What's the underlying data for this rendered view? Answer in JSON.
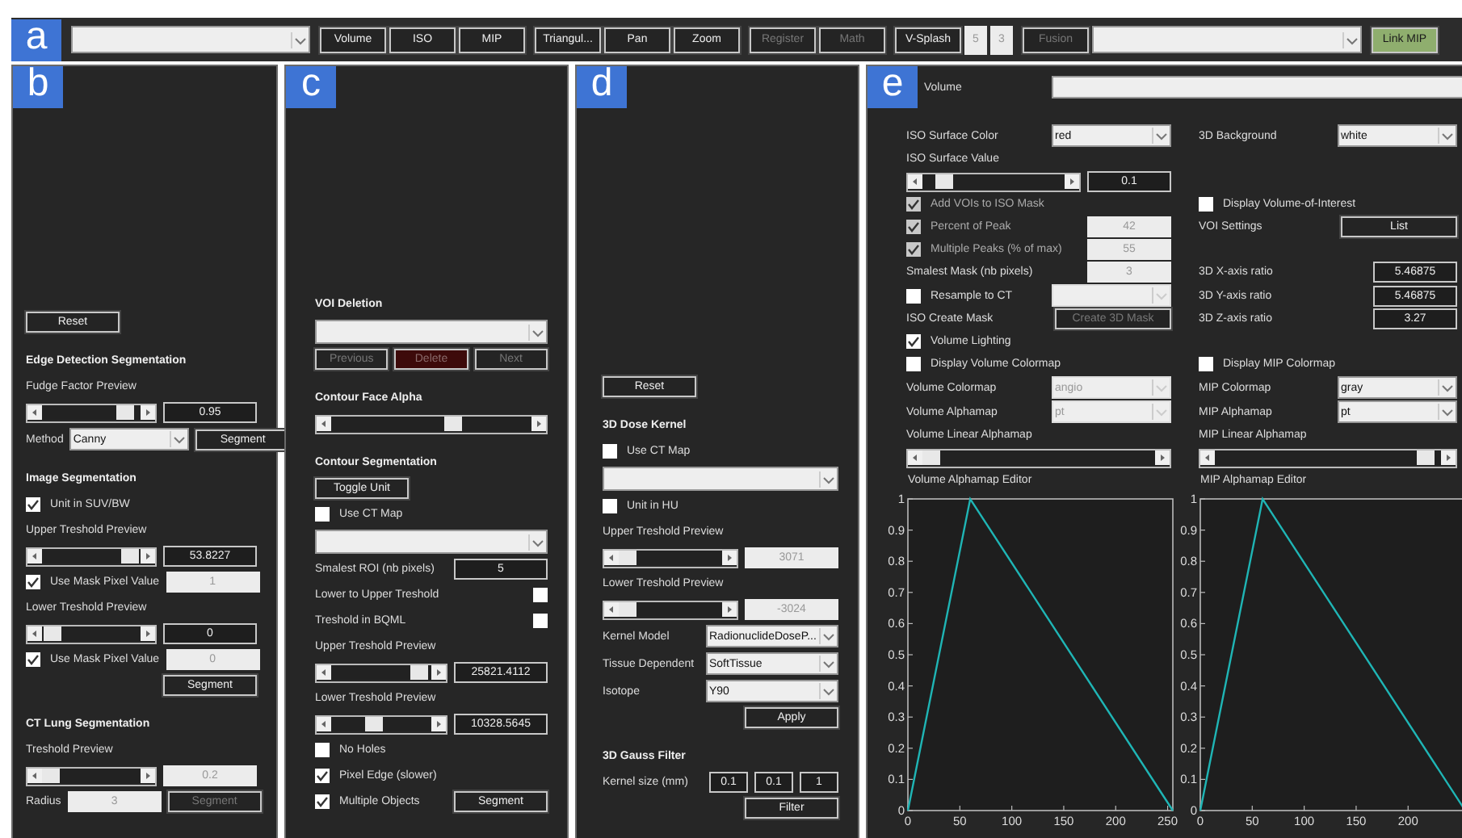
{
  "toolbar": {
    "letter": "a",
    "groups": [
      [
        {
          "kind": "dropdown",
          "disabled": false
        }
      ],
      [
        {
          "kind": "button",
          "label": "Volume",
          "disabled": false
        },
        {
          "kind": "button",
          "label": "ISO",
          "disabled": false
        },
        {
          "kind": "button",
          "label": "MIP",
          "disabled": false
        }
      ],
      [
        {
          "kind": "button",
          "label": "Triangul...",
          "disabled": false
        },
        {
          "kind": "button",
          "label": "Pan",
          "disabled": false
        },
        {
          "kind": "button",
          "label": "Zoom",
          "disabled": false
        }
      ],
      [
        {
          "kind": "button",
          "label": "Register",
          "disabled": true
        },
        {
          "kind": "button",
          "label": "Math",
          "disabled": true
        }
      ],
      [
        {
          "kind": "button",
          "label": "V-Splash",
          "disabled": false
        },
        {
          "kind": "field",
          "value": "5",
          "disabled": true
        },
        {
          "kind": "field",
          "value": "3",
          "disabled": true
        }
      ],
      [
        {
          "kind": "button",
          "label": "Fusion",
          "disabled": true
        },
        {
          "kind": "dropdown",
          "disabled": false
        }
      ],
      [
        {
          "kind": "button",
          "label": "Link MIP",
          "disabled": false,
          "color": "#8fae6e"
        }
      ]
    ]
  },
  "panels": [
    {
      "letter": "b",
      "rows": [
        {
          "items": [
            {
              "kind": "button",
              "label": "Reset",
              "disabled": false
            }
          ]
        },
        {
          "items": [
            {
              "kind": "heading",
              "text": "Edge Detection Segmentation"
            }
          ]
        },
        {
          "items": [
            {
              "kind": "text",
              "text": "Fudge Factor Preview"
            }
          ]
        },
        {
          "items": [
            {
              "kind": "slider",
              "level": 0.92
            },
            {
              "kind": "field",
              "value": "0.95",
              "disabled": false
            }
          ]
        },
        {
          "items": [
            {
              "kind": "text",
              "text": "Method"
            },
            {
              "kind": "dropdown",
              "value": "Canny",
              "disabled": false
            },
            {
              "kind": "button",
              "label": "Segment",
              "disabled": false
            }
          ]
        },
        {
          "items": [
            {
              "kind": "heading",
              "text": "Image Segmentation"
            }
          ]
        },
        {
          "items": [
            {
              "kind": "checkbox",
              "label": "Unit in SUV/BW",
              "checked": true,
              "disabled": false
            }
          ]
        },
        {
          "items": [
            {
              "kind": "text",
              "text": "Upper Treshold Preview"
            }
          ]
        },
        {
          "items": [
            {
              "kind": "slider",
              "level": 0.97
            },
            {
              "kind": "field",
              "value": "53.8227",
              "disabled": false
            }
          ]
        },
        {
          "items": [
            {
              "kind": "checkbox",
              "label": "Use Mask Pixel Value",
              "checked": true,
              "disabled": false
            },
            {
              "kind": "field",
              "value": "1",
              "disabled": true
            }
          ]
        },
        {
          "items": [
            {
              "kind": "text",
              "text": "Lower Treshold Preview"
            }
          ]
        },
        {
          "items": [
            {
              "kind": "slider",
              "level": 0.03
            },
            {
              "kind": "field",
              "value": "0",
              "disabled": false
            }
          ]
        },
        {
          "items": [
            {
              "kind": "checkbox",
              "label": "Use Mask Pixel Value",
              "checked": true,
              "disabled": false
            },
            {
              "kind": "field",
              "value": "0",
              "disabled": true
            }
          ]
        },
        {
          "items": [
            {
              "kind": "button",
              "label": "Segment",
              "disabled": false
            }
          ]
        },
        {
          "items": [
            {
              "kind": "heading",
              "text": "CT Lung Segmentation"
            }
          ]
        },
        {
          "items": [
            {
              "kind": "text",
              "text": "Treshold Preview"
            }
          ]
        },
        {
          "items": [
            {
              "kind": "slider",
              "level": 0
            },
            {
              "kind": "field",
              "value": "0.2",
              "disabled": true
            }
          ]
        },
        {
          "items": [
            {
              "kind": "text",
              "text": "Radius"
            },
            {
              "kind": "field",
              "value": "3",
              "disabled": true
            },
            {
              "kind": "button",
              "label": "Segment",
              "disabled": true
            }
          ]
        }
      ]
    },
    {
      "letter": "c",
      "rows": [
        {
          "items": [
            {
              "kind": "heading",
              "text": "VOI Deletion"
            }
          ]
        },
        {
          "items": [
            {
              "kind": "dropdown",
              "disabled": false
            }
          ]
        },
        {
          "items": [
            {
              "kind": "button",
              "label": "Previous",
              "disabled": true
            },
            {
              "kind": "button",
              "label": "Delete",
              "disabled": true,
              "color": "#3d0a0a"
            },
            {
              "kind": "button",
              "label": "Next",
              "disabled": true
            }
          ]
        },
        {
          "items": [
            {
              "kind": "heading",
              "text": "Contour Face Alpha"
            }
          ]
        },
        {
          "items": [
            {
              "kind": "slider",
              "level": 0.62
            }
          ]
        },
        {
          "items": [
            {
              "kind": "heading",
              "text": "Contour Segmentation"
            }
          ]
        },
        {
          "items": [
            {
              "kind": "button",
              "label": "Toggle Unit",
              "disabled": false
            }
          ]
        },
        {
          "items": [
            {
              "kind": "checkbox",
              "label": "Use CT Map",
              "checked": false,
              "disabled": false
            }
          ]
        },
        {
          "items": [
            {
              "kind": "dropdown",
              "disabled": false
            }
          ]
        },
        {
          "items": [
            {
              "kind": "text",
              "text": "Smalest ROI (nb pixels)"
            },
            {
              "kind": "field",
              "value": "5",
              "disabled": false
            }
          ]
        },
        {
          "items": [
            {
              "kind": "text",
              "text": "Lower to Upper Treshold"
            },
            {
              "kind": "checkbox",
              "checked": false,
              "disabled": false
            }
          ]
        },
        {
          "items": [
            {
              "kind": "text",
              "text": "Treshold in BQML"
            },
            {
              "kind": "checkbox",
              "checked": false,
              "disabled": false
            }
          ]
        },
        {
          "items": [
            {
              "kind": "text",
              "text": "Upper Treshold Preview"
            }
          ]
        },
        {
          "items": [
            {
              "kind": "slider",
              "level": 0.97
            },
            {
              "kind": "field",
              "value": "25821.4112",
              "disabled": false
            }
          ]
        },
        {
          "items": [
            {
              "kind": "text",
              "text": "Lower Treshold Preview"
            }
          ]
        },
        {
          "items": [
            {
              "kind": "slider",
              "level": 0.42
            },
            {
              "kind": "field",
              "value": "10328.5645",
              "disabled": false
            }
          ]
        },
        {
          "items": [
            {
              "kind": "checkbox",
              "label": "No Holes",
              "checked": false,
              "disabled": false
            }
          ]
        },
        {
          "items": [
            {
              "kind": "checkbox",
              "label": "Pixel Edge (slower)",
              "checked": true,
              "disabled": false
            }
          ]
        },
        {
          "items": [
            {
              "kind": "checkbox",
              "label": "Multiple Objects",
              "checked": true,
              "disabled": false
            },
            {
              "kind": "button",
              "label": "Segment",
              "disabled": false
            }
          ]
        }
      ]
    },
    {
      "letter": "d",
      "rows": [
        {
          "items": [
            {
              "kind": "button",
              "label": "Reset",
              "disabled": false
            }
          ]
        },
        {
          "items": [
            {
              "kind": "heading",
              "text": "3D Dose Kernel"
            }
          ]
        },
        {
          "items": [
            {
              "kind": "checkbox",
              "label": "Use CT Map",
              "checked": false,
              "disabled": false
            }
          ]
        },
        {
          "items": [
            {
              "kind": "dropdown",
              "disabled": false
            }
          ]
        },
        {
          "items": [
            {
              "kind": "checkbox",
              "label": "Unit in HU",
              "checked": false,
              "disabled": false
            }
          ]
        },
        {
          "items": [
            {
              "kind": "text",
              "text": "Upper Treshold Preview"
            }
          ]
        },
        {
          "items": [
            {
              "kind": "slider",
              "level": 0
            },
            {
              "kind": "field",
              "value": "3071",
              "disabled": true
            }
          ]
        },
        {
          "items": [
            {
              "kind": "text",
              "text": "Lower Treshold Preview"
            }
          ]
        },
        {
          "items": [
            {
              "kind": "slider",
              "level": 0
            },
            {
              "kind": "field",
              "value": "-3024",
              "disabled": true
            }
          ]
        },
        {
          "items": [
            {
              "kind": "text",
              "text": "Kernel Model"
            },
            {
              "kind": "dropdown",
              "value": "RadionuclideDoseP...",
              "disabled": false
            }
          ]
        },
        {
          "items": [
            {
              "kind": "text",
              "text": "Tissue Dependent"
            },
            {
              "kind": "dropdown",
              "value": "SoftTissue",
              "disabled": false
            }
          ]
        },
        {
          "items": [
            {
              "kind": "text",
              "text": "Isotope"
            },
            {
              "kind": "dropdown",
              "value": "Y90",
              "disabled": false
            }
          ]
        },
        {
          "items": [
            {
              "kind": "button",
              "label": "Apply",
              "disabled": false
            }
          ]
        },
        {
          "items": [
            {
              "kind": "heading",
              "text": "3D Gauss Filter"
            }
          ]
        },
        {
          "items": [
            {
              "kind": "text",
              "text": "Kernel size (mm)"
            },
            {
              "kind": "field",
              "value": "0.1",
              "disabled": false
            },
            {
              "kind": "field",
              "value": "0.1",
              "disabled": false
            },
            {
              "kind": "field",
              "value": "1",
              "disabled": false
            }
          ]
        },
        {
          "items": [
            {
              "kind": "button",
              "label": "Filter",
              "disabled": false
            }
          ]
        }
      ]
    }
  ],
  "volume_panel": {
    "letter": "e",
    "label": "Volume",
    "dropdown": {
      "kind": "dropdown",
      "disabled": false
    },
    "rows": [
      {
        "left": [
          {
            "kind": "text",
            "text": "ISO Surface Color"
          },
          {
            "kind": "dropdown",
            "value": "red",
            "disabled": false
          }
        ],
        "right": [
          {
            "kind": "text",
            "text": "3D Background"
          },
          {
            "kind": "dropdown",
            "value": "white",
            "disabled": false
          }
        ]
      },
      {
        "left": [
          {
            "kind": "text",
            "text": "ISO Surface Value"
          }
        ]
      },
      {
        "left": [
          {
            "kind": "slider",
            "level": 0.1
          },
          {
            "kind": "field",
            "value": "0.1",
            "disabled": false
          }
        ]
      },
      {
        "left": [
          {
            "kind": "checkbox",
            "label": "Add VOIs to ISO Mask",
            "checked": true,
            "disabled": true
          }
        ],
        "right": [
          {
            "kind": "checkbox",
            "label": "Display Volume-of-Interest",
            "checked": false,
            "disabled": false
          }
        ]
      },
      {
        "left": [
          {
            "kind": "checkbox",
            "label": "Percent of Peak",
            "checked": true,
            "disabled": true
          },
          {
            "kind": "field",
            "value": "42",
            "disabled": true
          }
        ],
        "right": [
          {
            "kind": "text",
            "text": "VOI Settings"
          },
          {
            "kind": "button",
            "label": "List",
            "disabled": false
          }
        ]
      },
      {
        "left": [
          {
            "kind": "checkbox",
            "label": "Multiple Peaks (% of max)",
            "checked": true,
            "disabled": true
          },
          {
            "kind": "field",
            "value": "55",
            "disabled": true
          }
        ]
      },
      {
        "left": [
          {
            "kind": "text",
            "text": "Smalest Mask (nb pixels)"
          },
          {
            "kind": "field",
            "value": "3",
            "disabled": true
          }
        ],
        "right": [
          {
            "kind": "text",
            "text": "3D X-axis ratio"
          },
          {
            "kind": "field",
            "value": "5.46875",
            "disabled": false
          }
        ]
      },
      {
        "left": [
          {
            "kind": "checkbox",
            "label": "Resample to CT",
            "checked": false,
            "disabled": false
          },
          {
            "kind": "dropdown",
            "disabled": true
          }
        ],
        "right": [
          {
            "kind": "text",
            "text": "3D Y-axis ratio"
          },
          {
            "kind": "field",
            "value": "5.46875",
            "disabled": false
          }
        ]
      },
      {
        "left": [
          {
            "kind": "text",
            "text": "ISO Create Mask"
          },
          {
            "kind": "button",
            "label": "Create 3D Mask",
            "disabled": true
          }
        ],
        "right": [
          {
            "kind": "text",
            "text": "3D Z-axis ratio"
          },
          {
            "kind": "field",
            "value": "3.27",
            "disabled": false
          }
        ]
      },
      {
        "left": [
          {
            "kind": "checkbox",
            "label": "Volume Lighting",
            "checked": true,
            "disabled": false
          }
        ]
      },
      {
        "left": [
          {
            "kind": "checkbox",
            "label": "Display Volume Colormap",
            "checked": false,
            "disabled": false
          }
        ],
        "right": [
          {
            "kind": "checkbox",
            "label": "Display MIP Colormap",
            "checked": false,
            "disabled": false
          }
        ]
      },
      {
        "left": [
          {
            "kind": "text",
            "text": "Volume Colormap"
          },
          {
            "kind": "dropdown",
            "value": "angio",
            "disabled": true
          }
        ],
        "right": [
          {
            "kind": "text",
            "text": "MIP Colormap"
          },
          {
            "kind": "dropdown",
            "value": "gray",
            "disabled": false
          }
        ]
      },
      {
        "left": [
          {
            "kind": "text",
            "text": "Volume Alphamap"
          },
          {
            "kind": "dropdown",
            "value": "pt",
            "disabled": true
          }
        ],
        "right": [
          {
            "kind": "text",
            "text": "MIP Alphamap"
          },
          {
            "kind": "dropdown",
            "value": "pt",
            "disabled": false
          }
        ]
      },
      {
        "left": [
          {
            "kind": "text",
            "text": "Volume Linear Alphamap"
          }
        ],
        "right": [
          {
            "kind": "text",
            "text": "MIP Linear Alphamap"
          }
        ]
      },
      {
        "left": [
          {
            "kind": "slider",
            "level": 0
          }
        ],
        "right": [
          {
            "kind": "slider",
            "level": 0.97
          }
        ]
      }
    ],
    "charts": [
      {
        "title": "Volume Alphamap Editor",
        "chart_data": {
          "type": "line",
          "x": [
            0,
            60,
            255
          ],
          "series": [
            {
              "color": "#1fb5b5",
              "values": [
                0,
                1,
                0
              ]
            }
          ],
          "xlim": [
            0,
            255
          ],
          "ylim": [
            0,
            1
          ],
          "xticks": [
            0,
            50,
            100,
            150,
            200,
            250
          ],
          "yticks": [
            0,
            0.1,
            0.2,
            0.3,
            0.4,
            0.5,
            0.6,
            0.7,
            0.8,
            0.9,
            1
          ]
        }
      },
      {
        "title": "MIP Alphamap Editor",
        "chart_data": {
          "type": "line",
          "x": [
            0,
            60,
            255
          ],
          "series": [
            {
              "color": "#1fb5b5",
              "values": [
                0,
                1,
                0
              ]
            }
          ],
          "xlim": [
            0,
            255
          ],
          "ylim": [
            0,
            1
          ],
          "xticks": [
            0,
            50,
            100,
            150,
            200
          ],
          "yticks": [
            0,
            0.1,
            0.2,
            0.3,
            0.4,
            0.5,
            0.6,
            0.7,
            0.8,
            0.9,
            1
          ]
        }
      }
    ]
  }
}
